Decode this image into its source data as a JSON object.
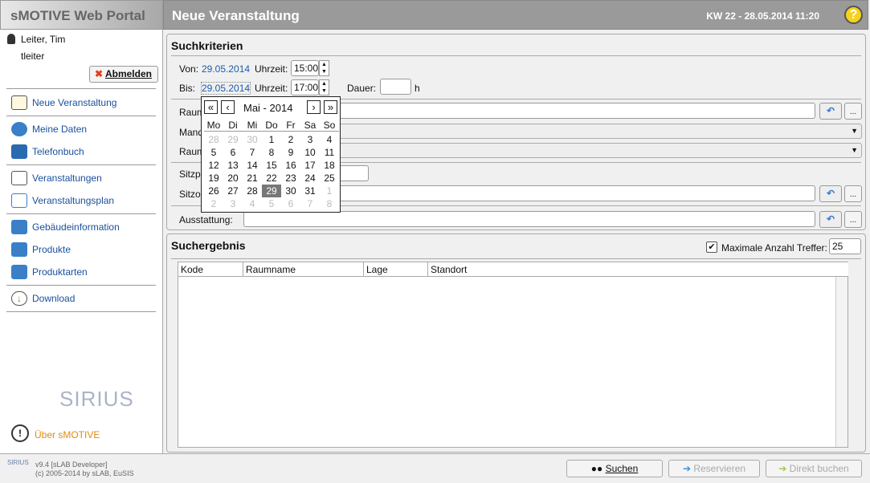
{
  "header": {
    "app_title": "sMOTIVE Web Portal",
    "page_title": "Neue Veranstaltung",
    "datetime": "KW 22 - 28.05.2014 11:20",
    "help": "?"
  },
  "user": {
    "name": "Leiter, Tim",
    "login": "tleiter",
    "logout": "Abmelden"
  },
  "sidebar": {
    "items": [
      {
        "label": "Neue Veranstaltung",
        "icon": "new-event-icon",
        "color": "#f0a030"
      },
      {
        "label": "Meine Daten",
        "icon": "user-data-icon",
        "color": "#3a7fc8"
      },
      {
        "label": "Telefonbuch",
        "icon": "phonebook-icon",
        "color": "#2a6ab0"
      },
      {
        "label": "Veranstaltungen",
        "icon": "presentation-icon",
        "color": "#555555"
      },
      {
        "label": "Veranstaltungsplan",
        "icon": "schedule-icon",
        "color": "#3a7fc8"
      },
      {
        "label": "Gebäudeinformation",
        "icon": "building-icon",
        "color": "#3a7fc8"
      },
      {
        "label": "Produkte",
        "icon": "product-icon",
        "color": "#3a7fc8"
      },
      {
        "label": "Produktarten",
        "icon": "product-type-icon",
        "color": "#3a7fc8"
      },
      {
        "label": "Download",
        "icon": "cloud-download-icon",
        "color": "#5aa040"
      }
    ],
    "logo": "SIRIUS",
    "about": "Über sMOTIVE"
  },
  "search": {
    "title": "Suchkriterien",
    "von_label": "Von:",
    "von_date": "29.05.2014",
    "time_label": "Uhrzeit:",
    "von_time": "15:00",
    "bis_label": "Bis:",
    "bis_date": "29.05.2014",
    "bis_time": "17:00",
    "dauer_label": "Dauer:",
    "dauer_unit": "h",
    "raum_label": "Raumname:",
    "mandant_label": "Mandant:",
    "raumtyp_label": "Raumtyp:",
    "sitzplaetze_label": "Sitzplätze:",
    "sitzordnung_label": "Sitzordnung:",
    "ausstattung_label": "Ausstattung:",
    "more": "..."
  },
  "calendar": {
    "month": "Mai - 2014",
    "weekdays": [
      "Mo",
      "Di",
      "Mi",
      "Do",
      "Fr",
      "Sa",
      "So"
    ],
    "days": [
      "28",
      "29",
      "30",
      "1",
      "2",
      "3",
      "4",
      "5",
      "6",
      "7",
      "8",
      "9",
      "10",
      "11",
      "12",
      "13",
      "14",
      "15",
      "16",
      "17",
      "18",
      "19",
      "20",
      "21",
      "22",
      "23",
      "24",
      "25",
      "26",
      "27",
      "28",
      "29",
      "30",
      "31",
      "1",
      "2",
      "3",
      "4",
      "5",
      "6",
      "7",
      "8"
    ],
    "selected": "29"
  },
  "results": {
    "title": "Suchergebnis",
    "max_label": "Maximale Anzahl Treffer:",
    "max_value": "25",
    "max_checked": true,
    "columns": [
      "Kode",
      "Raumname",
      "Lage",
      "Standort"
    ]
  },
  "footer": {
    "version": "v9.4 [sLAB Developer]",
    "copyright": "(c) 2005-2014 by sLAB, EuSIS",
    "search": "Suchen",
    "reserve": "Reservieren",
    "book": "Direkt buchen"
  }
}
